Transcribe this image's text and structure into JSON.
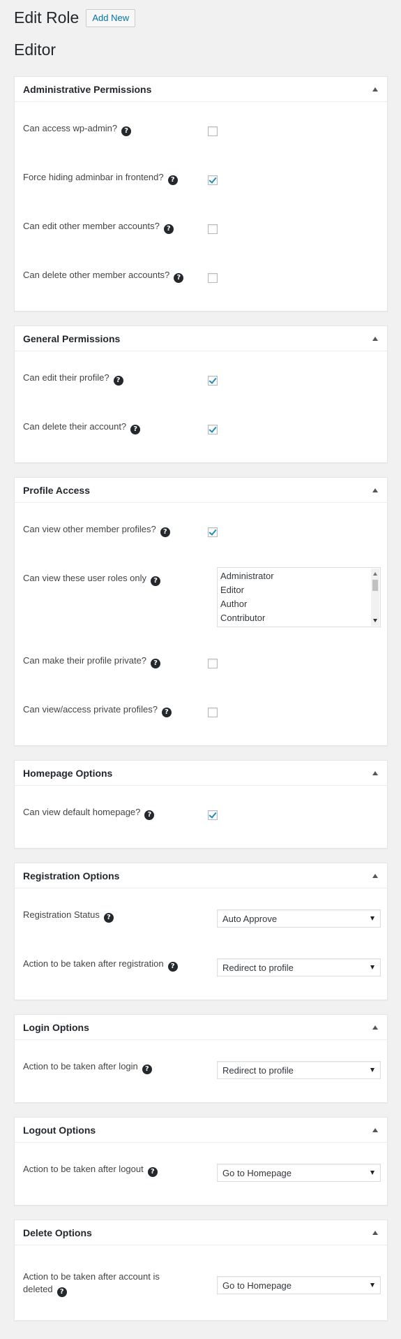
{
  "header": {
    "title": "Edit Role",
    "add_new_label": "Add New",
    "role_name": "Editor"
  },
  "icons": {
    "help": "question-mark-circle-icon",
    "collapse": "triangle-up-icon"
  },
  "colors": {
    "link": "#0073aa",
    "check": "#1e8cbe"
  },
  "panels": {
    "admin": {
      "title": "Administrative Permissions",
      "rows": [
        {
          "label": "Can access wp-admin?",
          "checked": false
        },
        {
          "label": "Force hiding adminbar in frontend?",
          "checked": true
        },
        {
          "label": "Can edit other member accounts?",
          "checked": false
        },
        {
          "label": "Can delete other member accounts?",
          "checked": false
        }
      ]
    },
    "general": {
      "title": "General Permissions",
      "rows": [
        {
          "label": "Can edit their profile?",
          "checked": true
        },
        {
          "label": "Can delete their account?",
          "checked": true
        }
      ]
    },
    "profile": {
      "title": "Profile Access",
      "view_others": {
        "label": "Can view other member profiles?",
        "checked": true
      },
      "roles_only": {
        "label": "Can view these user roles only",
        "options": [
          "Administrator",
          "Editor",
          "Author",
          "Contributor"
        ]
      },
      "make_private": {
        "label": "Can make their profile private?",
        "checked": false
      },
      "view_private": {
        "label": "Can view/access private profiles?",
        "checked": false
      }
    },
    "homepage": {
      "title": "Homepage Options",
      "rows": [
        {
          "label": "Can view default homepage?",
          "checked": true
        }
      ]
    },
    "registration": {
      "title": "Registration Options",
      "status": {
        "label": "Registration Status",
        "value": "Auto Approve"
      },
      "action": {
        "label": "Action to be taken after registration",
        "value": "Redirect to profile"
      }
    },
    "login": {
      "title": "Login Options",
      "action": {
        "label": "Action to be taken after login",
        "value": "Redirect to profile"
      }
    },
    "logout": {
      "title": "Logout Options",
      "action": {
        "label": "Action to be taken after logout",
        "value": "Go to Homepage"
      }
    },
    "delete": {
      "title": "Delete Options",
      "action": {
        "label": "Action to be taken after account is deleted",
        "value": "Go to Homepage"
      }
    }
  }
}
